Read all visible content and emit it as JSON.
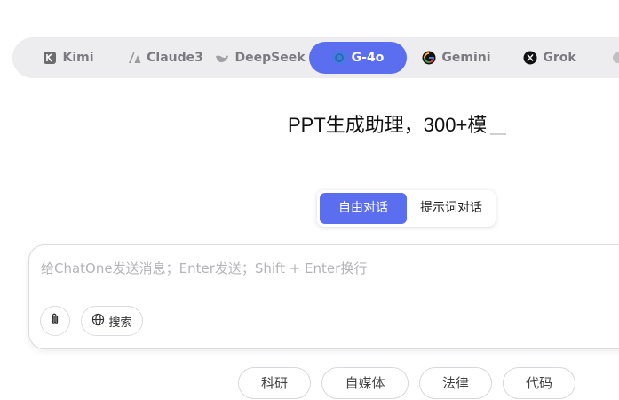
{
  "models": [
    {
      "label": "Kimi",
      "icon": "kimi-icon"
    },
    {
      "label": "Claude3",
      "icon": "claude-icon"
    },
    {
      "label": "DeepSeek",
      "icon": "deepseek-icon"
    },
    {
      "label": "G-4o",
      "icon": "openai-icon",
      "active": true
    },
    {
      "label": "Gemini",
      "icon": "gemini-icon"
    },
    {
      "label": "Grok",
      "icon": "grok-icon"
    }
  ],
  "title": "PPT生成助理，300+模",
  "modes": {
    "free": "自由对话",
    "prompt": "提示词对话"
  },
  "chat": {
    "placeholder": "给ChatOne发送消息；Enter发送；Shift + Enter换行",
    "search_label": "搜索"
  },
  "quick_tags": [
    "科研",
    "自媒体",
    "法律",
    "代码"
  ],
  "colors": {
    "accent": "#5b6ef0",
    "tab_bar_bg": "#ededf0"
  }
}
